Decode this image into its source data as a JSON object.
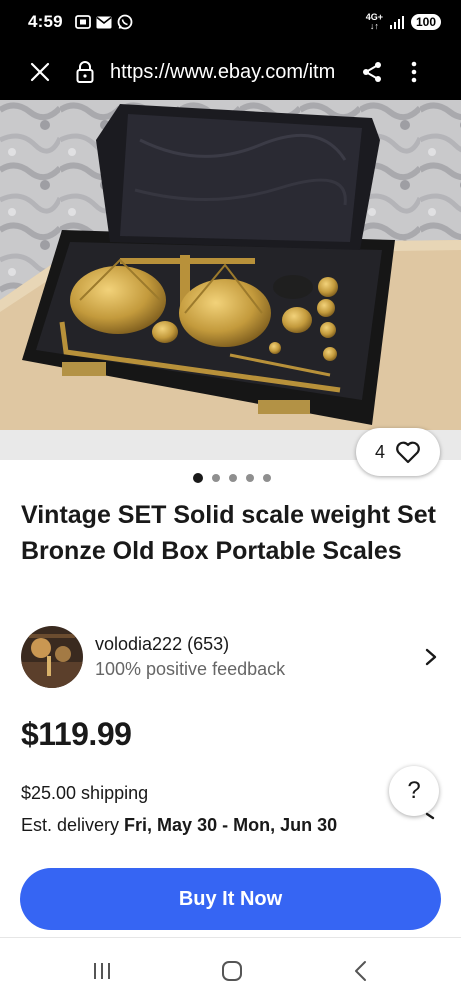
{
  "status_bar": {
    "time": "4:59",
    "network_top": "4G+",
    "network_bottom": "↓↑",
    "battery": "100"
  },
  "browser": {
    "url": "https://www.ebay.com/itm"
  },
  "listing": {
    "watchers": "4",
    "carousel_total": 5,
    "carousel_active": 0,
    "title": "Vintage SET Solid scale weight Set Bronze Old Box Portable Scales",
    "seller": {
      "name": "volodia222 (653)",
      "feedback": "100% positive feedback"
    },
    "price": "$119.99",
    "shipping": "$25.00 shipping",
    "delivery_label": "Est. delivery ",
    "delivery_dates": "Fri, May 30 - Mon, Jun 30",
    "help_label": "?",
    "buy_button": "Buy It Now"
  },
  "colors": {
    "accent": "#3665f3",
    "text": "#191919",
    "muted": "#666666"
  }
}
